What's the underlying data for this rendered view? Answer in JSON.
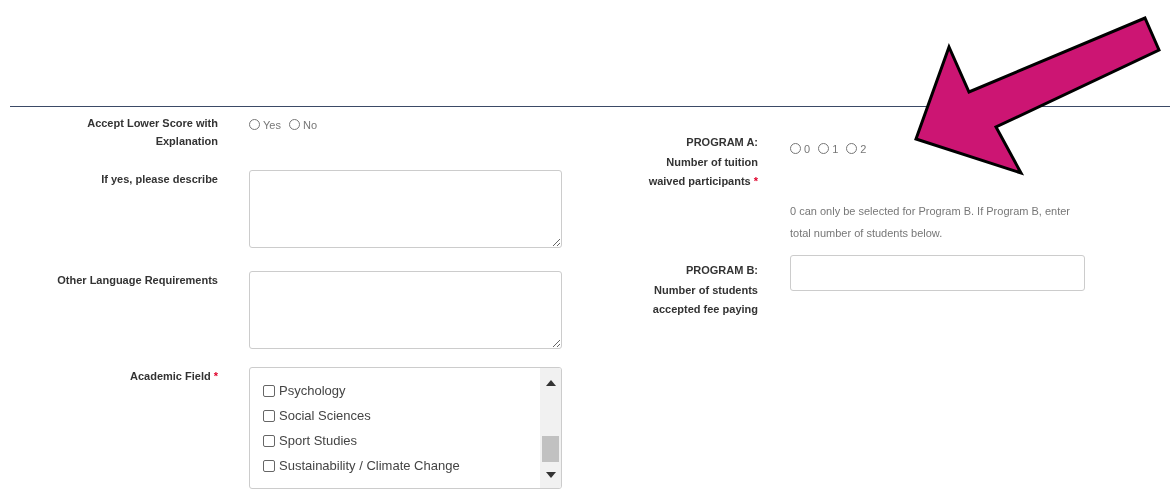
{
  "left": [
    {
      "kind": "radio",
      "label": "Accept Lower Score with Explanation",
      "options": [
        {
          "label": "Yes",
          "selected": false
        },
        {
          "label": "No",
          "selected": false
        }
      ]
    },
    {
      "kind": "textarea",
      "label": "If yes, please describe"
    },
    {
      "kind": "textarea",
      "label": "Other Language Requirements"
    },
    {
      "kind": "checklist",
      "label": "Academic Field",
      "required_mark": "*",
      "items": [
        {
          "label": "Psychology",
          "checked": false
        },
        {
          "label": "Social Sciences",
          "checked": false
        },
        {
          "label": "Sport Studies",
          "checked": false
        },
        {
          "label": "Sustainability / Climate Change",
          "checked": false
        }
      ]
    }
  ],
  "right": [
    {
      "kind": "radio",
      "label_lines": [
        "PROGRAM A:",
        "Number of tuition",
        "waived participants"
      ],
      "required_mark": "*",
      "options": [
        {
          "label": "0",
          "selected": false
        },
        {
          "label": "1",
          "selected": false
        },
        {
          "label": "2",
          "selected": false
        }
      ],
      "help": "0 can only be selected for Program B. If Program B, enter total number of students below."
    },
    {
      "kind": "input",
      "label_lines": [
        "PROGRAM B:",
        "Number of students",
        "accepted fee paying"
      ]
    }
  ]
}
